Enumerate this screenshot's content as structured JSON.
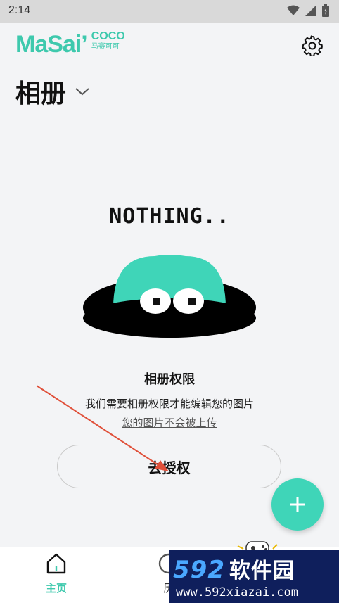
{
  "status_bar": {
    "time": "2:14"
  },
  "brand": {
    "logo": "MaSai’",
    "logo_sub": "COCO",
    "logo_cn": "马赛可可"
  },
  "header": {
    "title": "相册",
    "settings_icon": "gear-icon",
    "dropdown_icon": "chevron-down-icon"
  },
  "empty_state": {
    "heading": "NOTHING.."
  },
  "permission": {
    "title": "相册权限",
    "description": "我们需要相册权限才能编辑您的图片",
    "note": "您的图片不会被上传",
    "button_label": "去授权"
  },
  "fab": {
    "icon": "plus-icon"
  },
  "bottom_nav": {
    "items": [
      {
        "label": "主页",
        "icon": "home-icon",
        "active": true
      },
      {
        "label": "历",
        "icon": "history-icon",
        "active": false
      }
    ]
  },
  "watermark": {
    "brand": "592",
    "brand_cn": "软件园",
    "url": "www.592xiazai.com"
  },
  "colors": {
    "accent": "#3ec9ad",
    "fab": "#3fd5b8",
    "background": "#f3f4f6"
  }
}
